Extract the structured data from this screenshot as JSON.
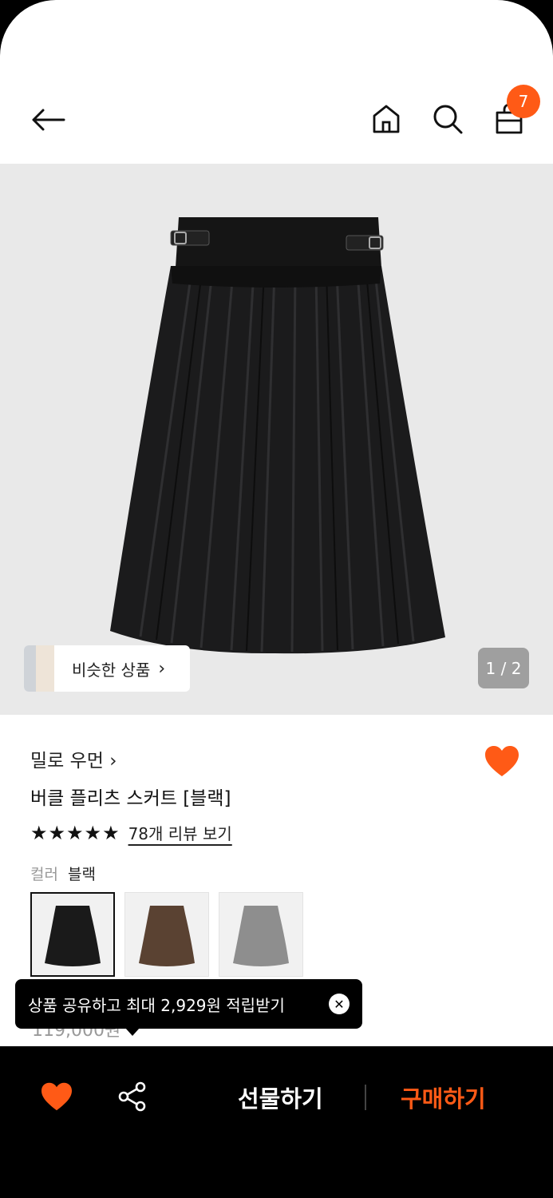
{
  "header": {
    "back_icon": "arrow-left-icon",
    "home_icon": "home-icon",
    "search_icon": "search-icon",
    "cart_icon": "shopping-bag-icon",
    "cart_count": "7"
  },
  "hero": {
    "similar_label": "비슷한 상품",
    "similar_arrow": "›",
    "counter": "1 / 2"
  },
  "product": {
    "brand": "밀로 우먼 ›",
    "title": "버클 플리츠 스커트 [블랙]",
    "stars": "★★★★★",
    "reviews": "78개 리뷰 보기",
    "color_key": "컬러",
    "color_value": "블랙",
    "swatches": [
      {
        "name": "black",
        "color": "#1a1a1a"
      },
      {
        "name": "brown",
        "color": "#5a4232"
      },
      {
        "name": "gray",
        "color": "#8e8e8e"
      }
    ],
    "price_partial": "119,000원"
  },
  "tooltip": {
    "text": "상품 공유하고 최대 2,929원 적립받기",
    "close": "✕"
  },
  "bottom": {
    "gift": "선물하기",
    "buy": "구매하기"
  },
  "colors": {
    "accent": "#ff5a16",
    "hero_bg": "#e9e9e9"
  }
}
